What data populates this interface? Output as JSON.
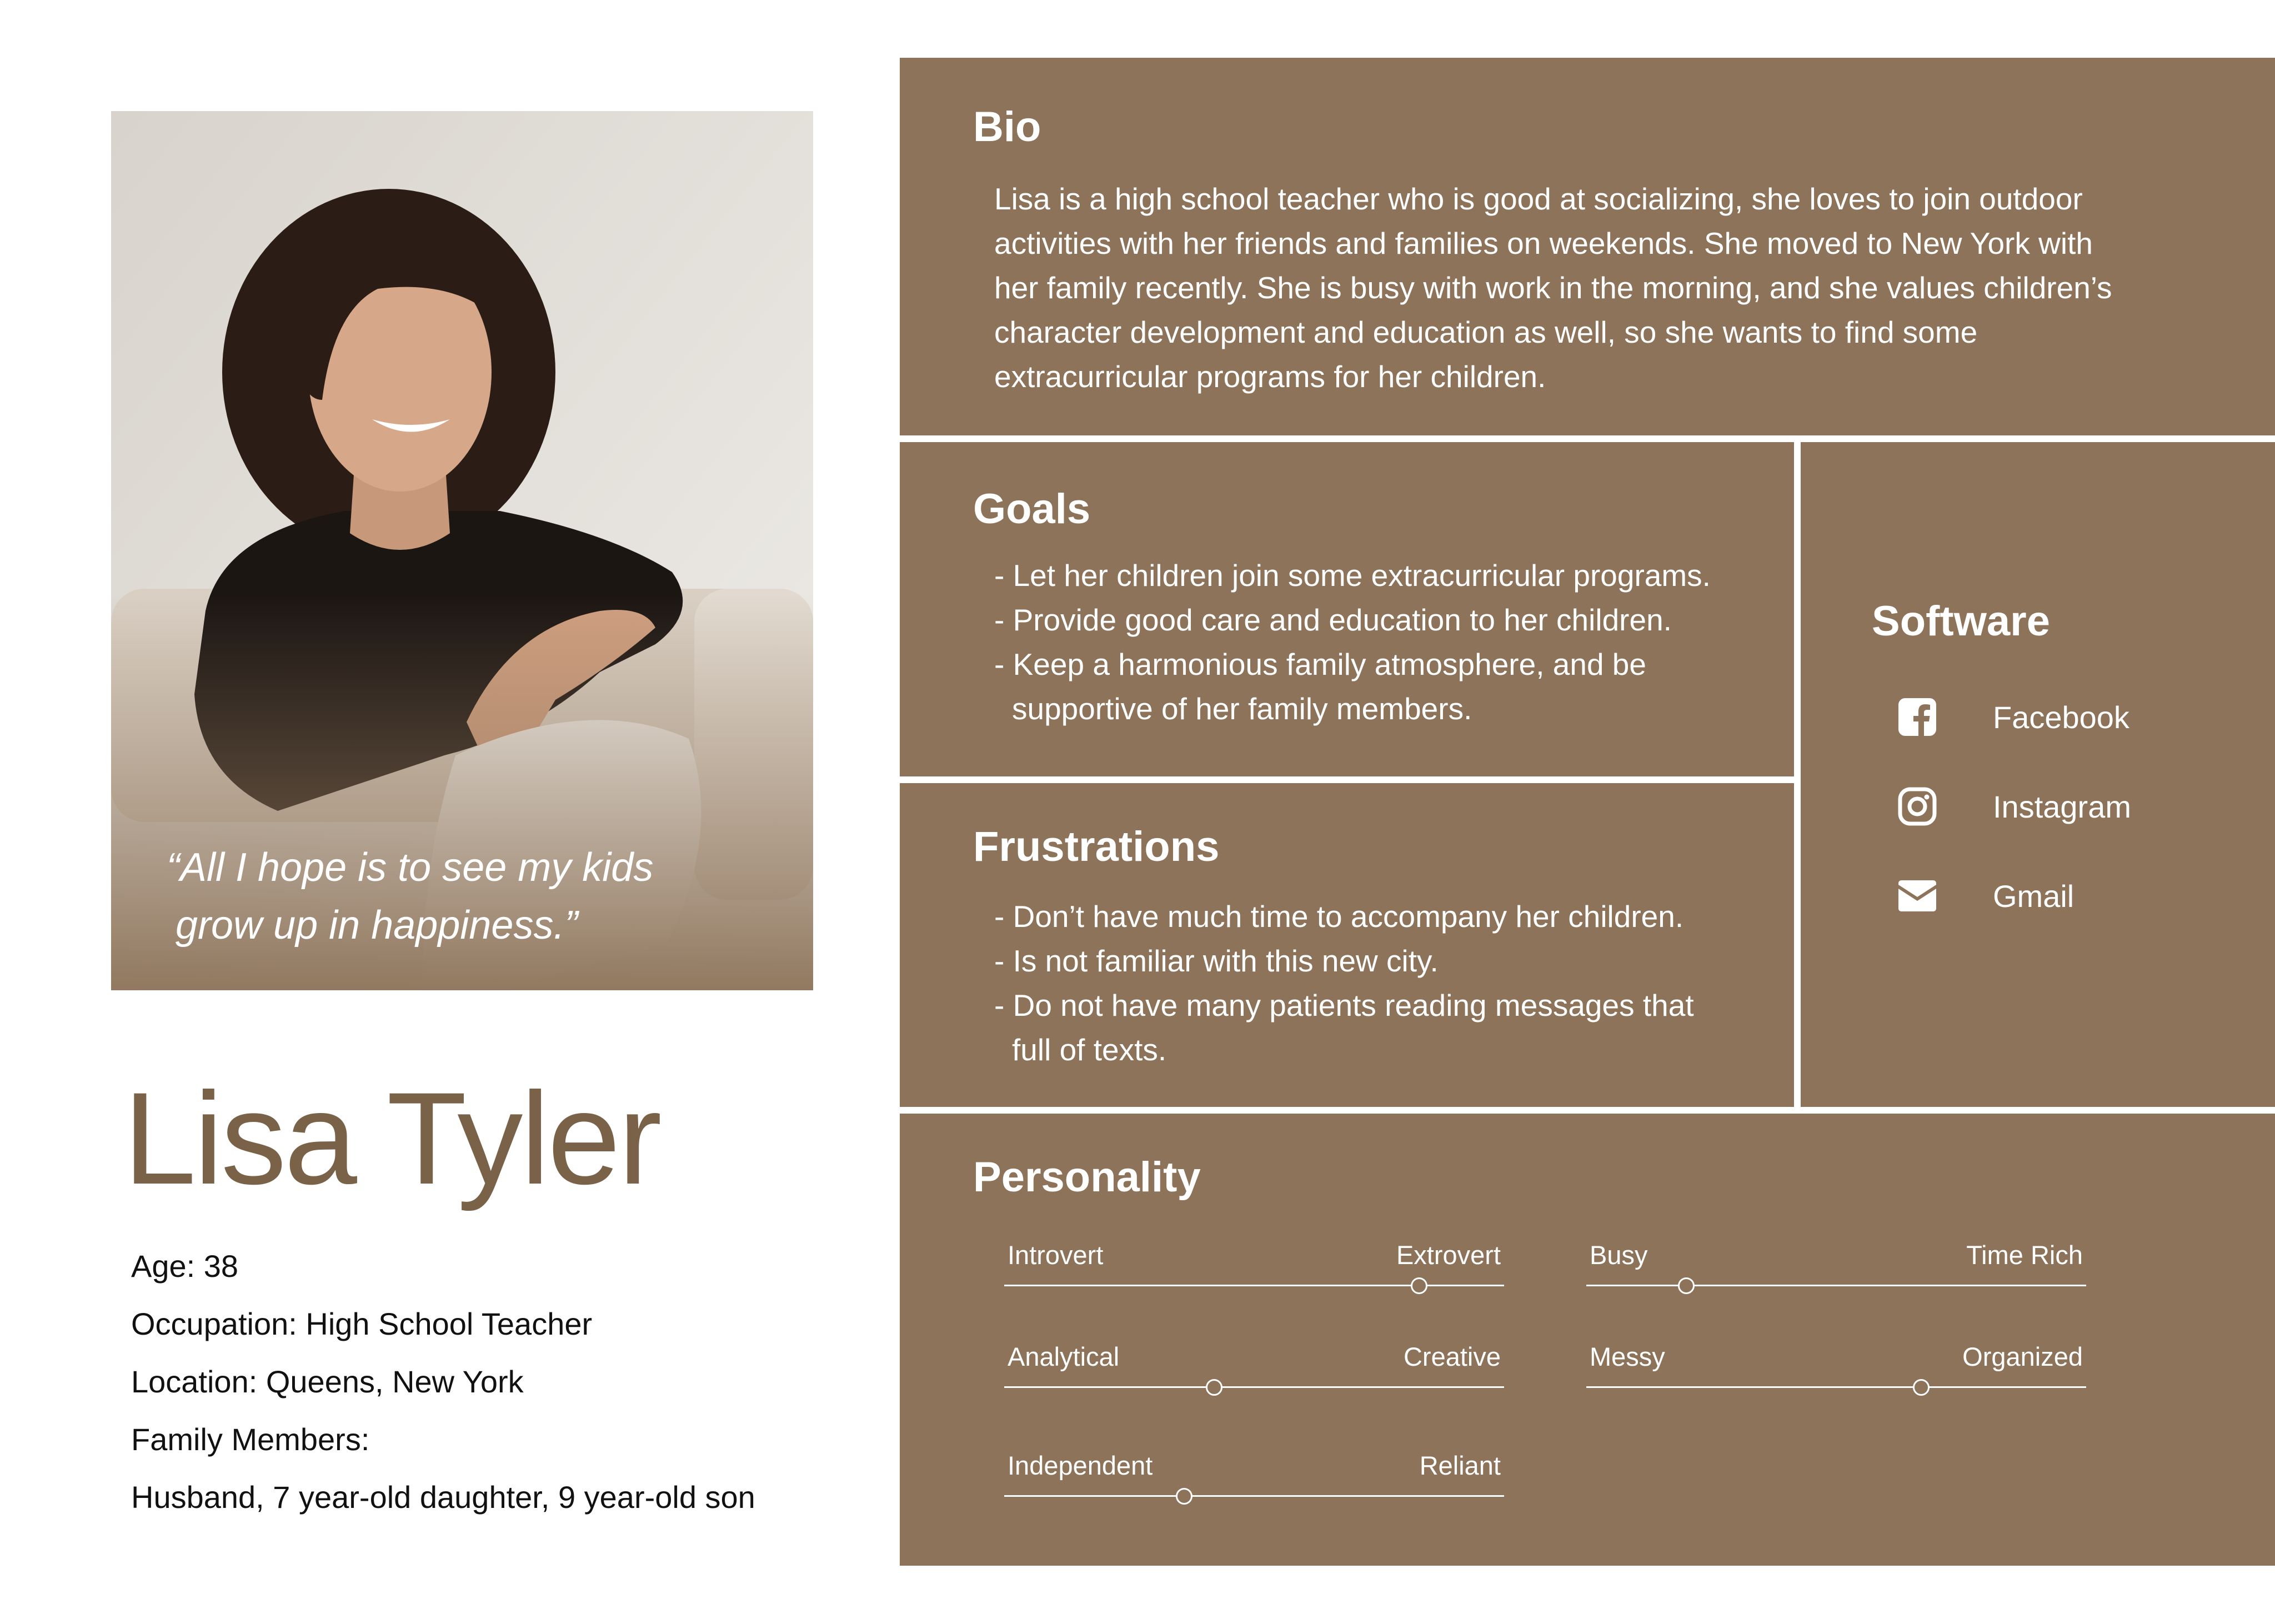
{
  "persona": {
    "quote_line1": "“All I hope is to see my kids",
    "quote_line2": "grow up in happiness.”",
    "name": "Lisa Tyler",
    "facts": [
      "Age: 38",
      "Occupation: High School Teacher",
      "Location: Queens, New York",
      "Family Members:",
      "Husband, 7 year-old daughter, 9 year-old son"
    ]
  },
  "bio": {
    "title": "Bio",
    "text": "Lisa is a high school teacher who is good at socializing, she loves to join outdoor activities with her friends and families on weekends. She moved to New York with her family recently. She is busy with work in the morning, and she values children’s character development and education as well, so she wants to find some extracurricular programs for her children."
  },
  "goals": {
    "title": "Goals",
    "items": [
      "- Let her children join some extracurricular programs.",
      "- Provide good care and education to her children.",
      "- Keep a harmonious family atmosphere, and be supportive of her family members."
    ]
  },
  "frustrations": {
    "title": "Frustrations",
    "items": [
      "- Don’t have much time to accompany her children.",
      "- Is not familiar with this new city.",
      "- Do not have many patients reading messages that full of texts."
    ]
  },
  "software": {
    "title": "Software",
    "items": [
      {
        "label": "Facebook",
        "icon": "facebook-icon"
      },
      {
        "label": "Instagram",
        "icon": "instagram-icon"
      },
      {
        "label": "Gmail",
        "icon": "mail-icon"
      }
    ]
  },
  "personality": {
    "title": "Personality",
    "traits": [
      {
        "left": "Introvert",
        "right": "Extrovert",
        "value": 0.83
      },
      {
        "left": "Busy",
        "right": "Time Rich",
        "value": 0.2
      },
      {
        "left": "Analytical",
        "right": "Creative",
        "value": 0.42
      },
      {
        "left": "Messy",
        "right": "Organized",
        "value": 0.67
      },
      {
        "left": "Independent",
        "right": "Reliant",
        "value": 0.36
      }
    ]
  },
  "colors": {
    "panel": "#8d7359",
    "name_text": "#7a6249"
  }
}
